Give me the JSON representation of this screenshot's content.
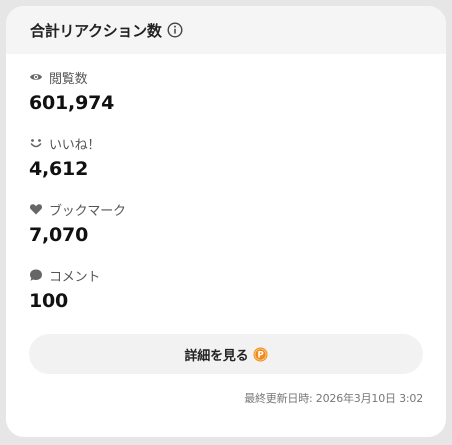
{
  "header": {
    "title": "合計リアクション数",
    "info_icon": "info-icon"
  },
  "stats": [
    {
      "icon": "eye-icon",
      "label": "閲覧数",
      "value": "601,974"
    },
    {
      "icon": "smile-icon",
      "label": "いいね！",
      "value": "4,612"
    },
    {
      "icon": "heart-icon",
      "label": "ブックマーク",
      "value": "7,070"
    },
    {
      "icon": "comment-icon",
      "label": "コメント",
      "value": "100"
    }
  ],
  "details_button": {
    "label": "詳細を見る",
    "badge_icon": "premium-p-icon",
    "badge_color": "#f08a1c"
  },
  "last_updated": "最終更新日時: 2026年3月10日 3:02"
}
